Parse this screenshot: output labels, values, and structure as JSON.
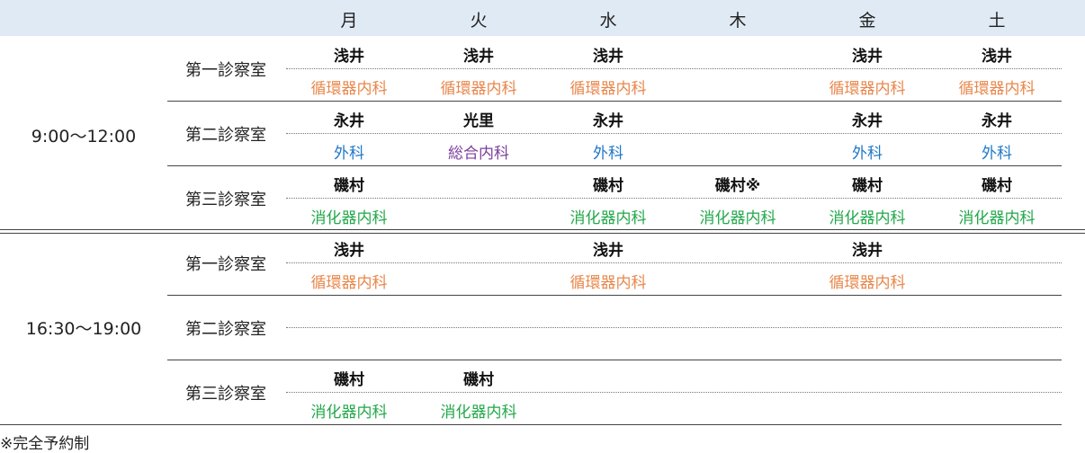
{
  "colors": {
    "header_bg": "#dfeaf4",
    "circulatory": "#e8864a",
    "surgery": "#1f78c8",
    "general": "#7b3f9e",
    "digestive": "#22a84a"
  },
  "days": [
    "月",
    "火",
    "水",
    "木",
    "金",
    "土"
  ],
  "time_slots": [
    {
      "label": "9:00〜12:00",
      "rooms": [
        {
          "name": "第一診察室",
          "cells": [
            {
              "doctor": "浅井",
              "dept": "循環器内科",
              "color": "#e8864a"
            },
            {
              "doctor": "浅井",
              "dept": "循環器内科",
              "color": "#e8864a"
            },
            {
              "doctor": "浅井",
              "dept": "循環器内科",
              "color": "#e8864a"
            },
            {
              "doctor": "",
              "dept": "",
              "color": ""
            },
            {
              "doctor": "浅井",
              "dept": "循環器内科",
              "color": "#e8864a"
            },
            {
              "doctor": "浅井",
              "dept": "循環器内科",
              "color": "#e8864a"
            }
          ]
        },
        {
          "name": "第二診察室",
          "cells": [
            {
              "doctor": "永井",
              "dept": "外科",
              "color": "#1f78c8"
            },
            {
              "doctor": "光里",
              "dept": "総合内科",
              "color": "#7b3f9e"
            },
            {
              "doctor": "永井",
              "dept": "外科",
              "color": "#1f78c8"
            },
            {
              "doctor": "",
              "dept": "",
              "color": ""
            },
            {
              "doctor": "永井",
              "dept": "外科",
              "color": "#1f78c8"
            },
            {
              "doctor": "永井",
              "dept": "外科",
              "color": "#1f78c8"
            }
          ]
        },
        {
          "name": "第三診察室",
          "cells": [
            {
              "doctor": "磯村",
              "dept": "消化器内科",
              "color": "#22a84a"
            },
            {
              "doctor": "",
              "dept": "",
              "color": ""
            },
            {
              "doctor": "磯村",
              "dept": "消化器内科",
              "color": "#22a84a"
            },
            {
              "doctor": "磯村※",
              "dept": "消化器内科",
              "color": "#22a84a"
            },
            {
              "doctor": "磯村",
              "dept": "消化器内科",
              "color": "#22a84a"
            },
            {
              "doctor": "磯村",
              "dept": "消化器内科",
              "color": "#22a84a"
            }
          ]
        }
      ]
    },
    {
      "label": "16:30〜19:00",
      "rooms": [
        {
          "name": "第一診察室",
          "cells": [
            {
              "doctor": "浅井",
              "dept": "循環器内科",
              "color": "#e8864a"
            },
            {
              "doctor": "",
              "dept": "",
              "color": ""
            },
            {
              "doctor": "浅井",
              "dept": "循環器内科",
              "color": "#e8864a"
            },
            {
              "doctor": "",
              "dept": "",
              "color": ""
            },
            {
              "doctor": "浅井",
              "dept": "循環器内科",
              "color": "#e8864a"
            },
            {
              "doctor": "",
              "dept": "",
              "color": ""
            }
          ]
        },
        {
          "name": "第二診察室",
          "cells": [
            {
              "doctor": "",
              "dept": "",
              "color": ""
            },
            {
              "doctor": "",
              "dept": "",
              "color": ""
            },
            {
              "doctor": "",
              "dept": "",
              "color": ""
            },
            {
              "doctor": "",
              "dept": "",
              "color": ""
            },
            {
              "doctor": "",
              "dept": "",
              "color": ""
            },
            {
              "doctor": "",
              "dept": "",
              "color": ""
            }
          ]
        },
        {
          "name": "第三診察室",
          "cells": [
            {
              "doctor": "磯村",
              "dept": "消化器内科",
              "color": "#22a84a"
            },
            {
              "doctor": "磯村",
              "dept": "消化器内科",
              "color": "#22a84a"
            },
            {
              "doctor": "",
              "dept": "",
              "color": ""
            },
            {
              "doctor": "",
              "dept": "",
              "color": ""
            },
            {
              "doctor": "",
              "dept": "",
              "color": ""
            },
            {
              "doctor": "",
              "dept": "",
              "color": ""
            }
          ]
        }
      ]
    }
  ],
  "note": "※完全予約制"
}
